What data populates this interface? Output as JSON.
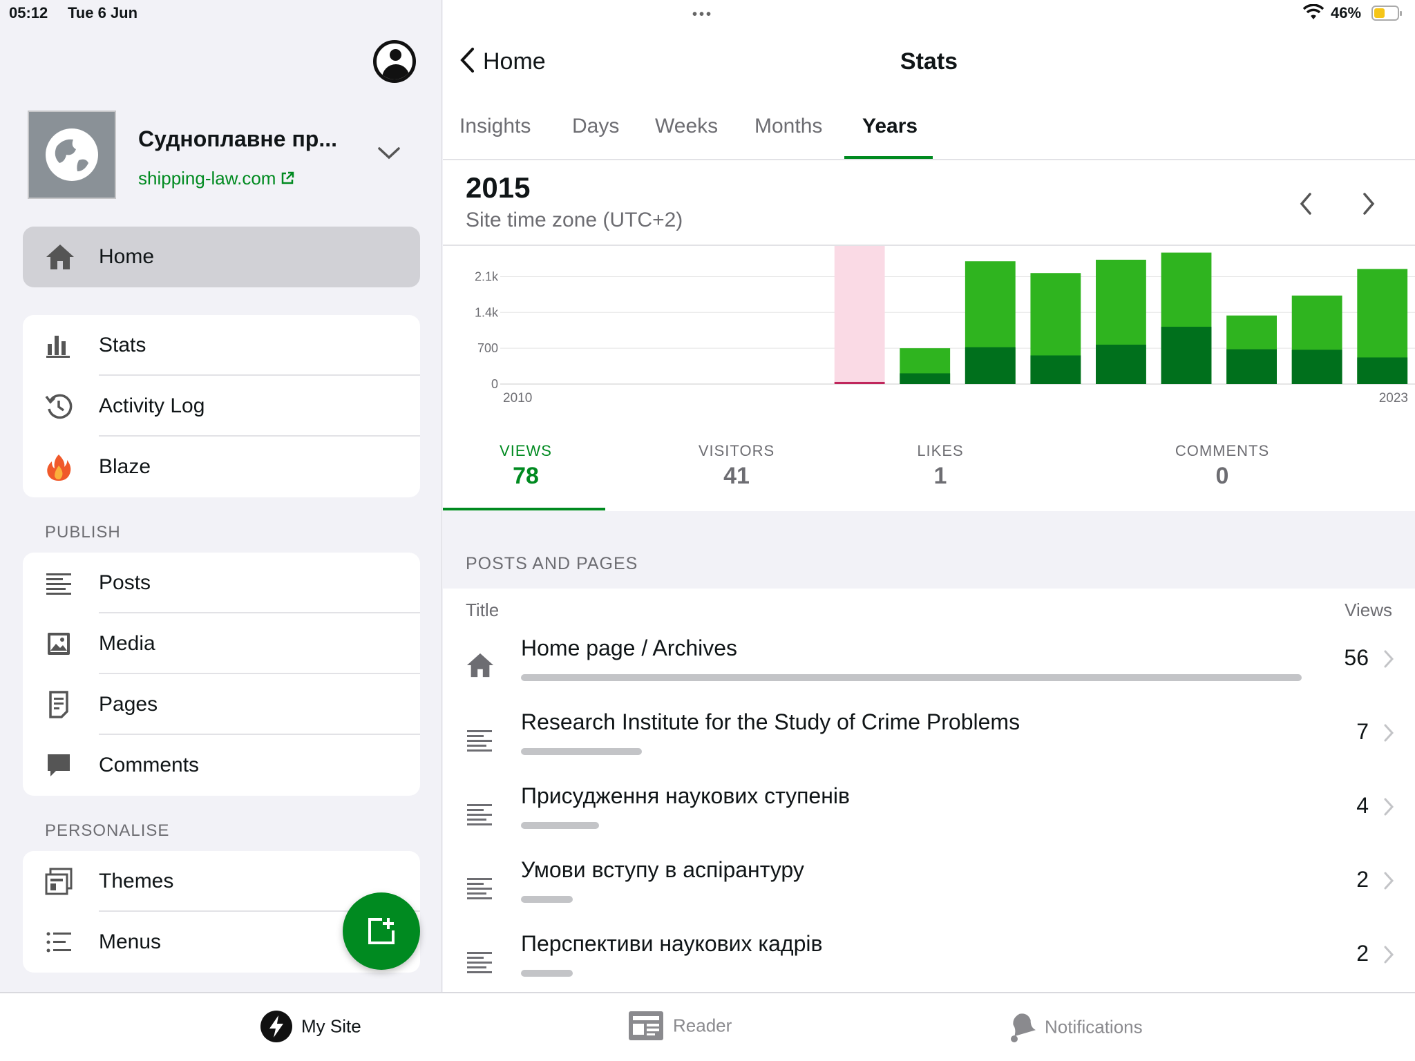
{
  "status_bar": {
    "time": "05:12",
    "date": "Tue 6 Jun",
    "battery": "46%"
  },
  "site": {
    "name": "Судноплавне пр...",
    "url": "shipping-law.com"
  },
  "sidebar": {
    "home_label": "Home",
    "main_items": [
      {
        "label": "Stats",
        "icon": "stats-icon"
      },
      {
        "label": "Activity Log",
        "icon": "history-icon"
      },
      {
        "label": "Blaze",
        "icon": "flame-icon"
      }
    ],
    "publish_heading": "PUBLISH",
    "publish_items": [
      {
        "label": "Posts",
        "icon": "posts-icon"
      },
      {
        "label": "Media",
        "icon": "media-icon"
      },
      {
        "label": "Pages",
        "icon": "pages-icon"
      },
      {
        "label": "Comments",
        "icon": "comment-icon"
      }
    ],
    "personalise_heading": "PERSONALISE",
    "personalise_items": [
      {
        "label": "Themes",
        "icon": "themes-icon"
      },
      {
        "label": "Menus",
        "icon": "menus-icon"
      }
    ]
  },
  "nav": {
    "back_label": "Home",
    "title": "Stats"
  },
  "tabs": [
    "Insights",
    "Days",
    "Weeks",
    "Months",
    "Years"
  ],
  "active_tab": "Years",
  "period": {
    "year": "2015",
    "timezone": "Site time zone (UTC+2)"
  },
  "chart_data": {
    "type": "bar",
    "x_start_label": "2010",
    "x_end_label": "2023",
    "y_ticks": [
      "0",
      "700",
      "1.4k",
      "2.1k"
    ],
    "y_tick_values": [
      0,
      700,
      1400,
      2100
    ],
    "ylim": [
      0,
      2700
    ],
    "categories": [
      "2010",
      "2011",
      "2012",
      "2013",
      "2014",
      "2015",
      "2016",
      "2017",
      "2018",
      "2019",
      "2020",
      "2021",
      "2022",
      "2023"
    ],
    "series": [
      {
        "name": "VIEWS",
        "values": [
          0,
          0,
          0,
          0,
          0,
          78,
          700,
          2400,
          2170,
          2430,
          2570,
          1340,
          1730,
          2250
        ]
      },
      {
        "name": "VISITORS",
        "values": [
          0,
          0,
          0,
          0,
          0,
          41,
          210,
          720,
          560,
          770,
          1120,
          680,
          670,
          520
        ]
      }
    ],
    "selected_category": "2015",
    "colors": {
      "views": "#2fb41f",
      "visitors": "#00701c",
      "selected_views": "#fadae5",
      "selected_visitors": "#c0275c",
      "gridline": "#e5e5e5"
    }
  },
  "metrics": [
    {
      "label": "VIEWS",
      "value": "78"
    },
    {
      "label": "VISITORS",
      "value": "41"
    },
    {
      "label": "LIKES",
      "value": "1"
    },
    {
      "label": "COMMENTS",
      "value": "0"
    }
  ],
  "posts_and_pages": {
    "heading": "POSTS AND PAGES",
    "title_col": "Title",
    "views_col": "Views",
    "rows": [
      {
        "title": "Home page / Archives",
        "views": "56",
        "bar_fraction": 1.0,
        "icon": "home-icon"
      },
      {
        "title": "Research  Institute for the Study of Crime Problems",
        "views": "7",
        "bar_fraction": 0.155,
        "icon": "post-icon"
      },
      {
        "title": "Присудження наукових ступенів",
        "views": "4",
        "bar_fraction": 0.1,
        "icon": "post-icon"
      },
      {
        "title": "Умови вступу в аспірантуру",
        "views": "2",
        "bar_fraction": 0.066,
        "icon": "post-icon"
      },
      {
        "title": "Перспективи наукових кадрів",
        "views": "2",
        "bar_fraction": 0.066,
        "icon": "post-icon"
      }
    ]
  },
  "tab_bar": [
    {
      "label": "My Site",
      "icon": "wordpress-icon"
    },
    {
      "label": "Reader",
      "icon": "reader-icon"
    },
    {
      "label": "Notifications",
      "icon": "bell-icon"
    }
  ],
  "accent_color": "#008a20"
}
